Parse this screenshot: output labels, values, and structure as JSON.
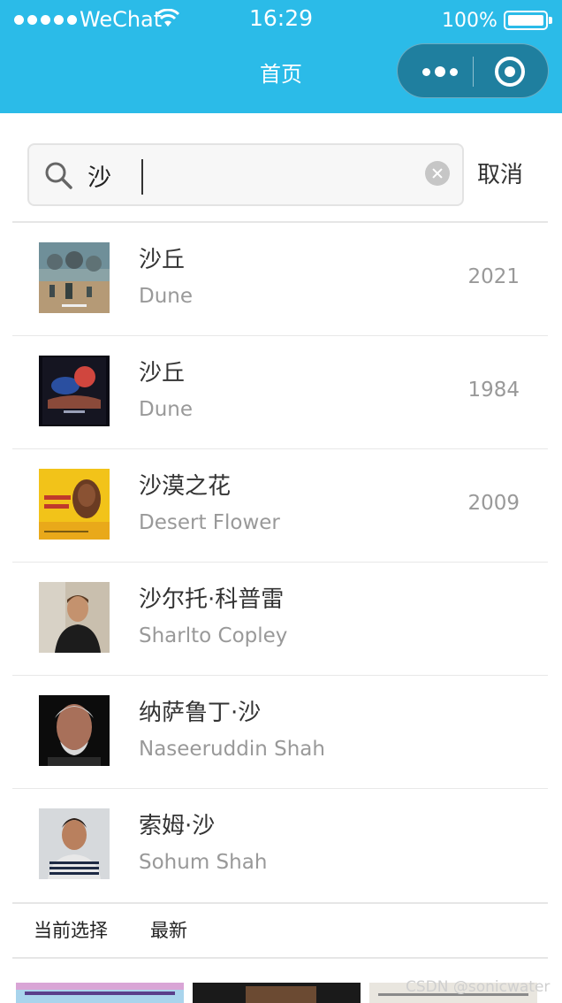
{
  "status_bar": {
    "carrier": "WeChat",
    "time": "16:29",
    "battery": "100%",
    "battery_level": 1.0
  },
  "nav": {
    "title": "首页",
    "more_icon": "more-dots-icon",
    "close_icon": "capsule-close-icon"
  },
  "search": {
    "value": "沙",
    "search_icon": "search-icon",
    "clear_icon": "clear-icon",
    "cancel_label": "取消"
  },
  "results": [
    {
      "title_cn": "沙丘",
      "title_en": "Dune",
      "year": "2021",
      "thumb": "dune-2021-poster"
    },
    {
      "title_cn": "沙丘",
      "title_en": "Dune",
      "year": "1984",
      "thumb": "dune-1984-poster"
    },
    {
      "title_cn": "沙漠之花",
      "title_en": "Desert Flower",
      "year": "2009",
      "thumb": "desert-flower-poster"
    },
    {
      "title_cn": "沙尔托·科普雷",
      "title_en": "Sharlto Copley",
      "year": "",
      "thumb": "person-photo"
    },
    {
      "title_cn": "纳萨鲁丁·沙",
      "title_en": "Naseeruddin Shah",
      "year": "",
      "thumb": "person-photo"
    },
    {
      "title_cn": "索姆·沙",
      "title_en": "Sohum Shah",
      "year": "",
      "thumb": "person-photo"
    }
  ],
  "tabs": {
    "current": "当前选择",
    "latest": "最新"
  },
  "watermark": "CSDN @sonicwater",
  "colors": {
    "header_bg": "#2bbbe8",
    "capsule_bg": "#1f7f9f",
    "secondary_text": "#999999"
  }
}
